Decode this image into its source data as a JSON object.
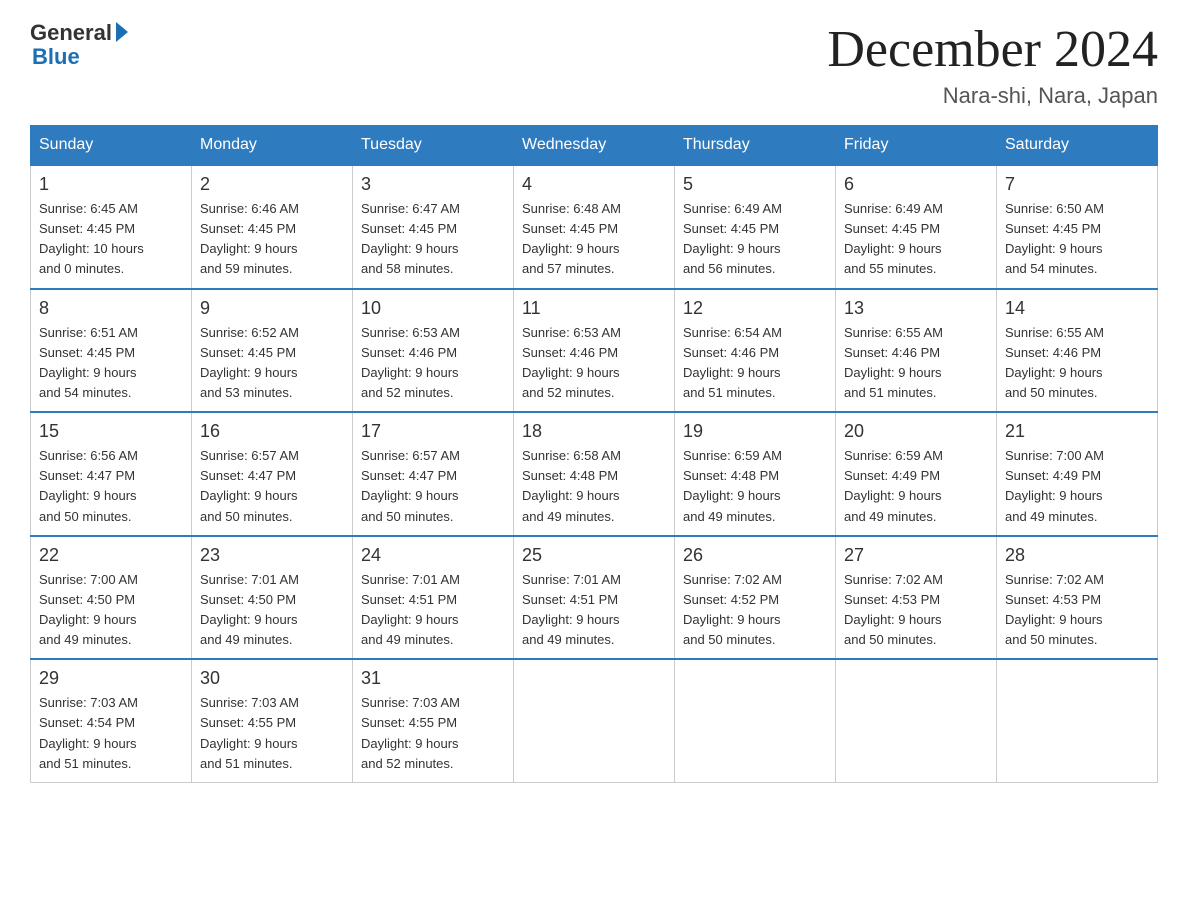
{
  "logo": {
    "general": "General",
    "blue": "Blue"
  },
  "title": "December 2024",
  "location": "Nara-shi, Nara, Japan",
  "weekdays": [
    "Sunday",
    "Monday",
    "Tuesday",
    "Wednesday",
    "Thursday",
    "Friday",
    "Saturday"
  ],
  "weeks": [
    [
      {
        "day": "1",
        "sunrise": "6:45 AM",
        "sunset": "4:45 PM",
        "daylight": "10 hours and 0 minutes."
      },
      {
        "day": "2",
        "sunrise": "6:46 AM",
        "sunset": "4:45 PM",
        "daylight": "9 hours and 59 minutes."
      },
      {
        "day": "3",
        "sunrise": "6:47 AM",
        "sunset": "4:45 PM",
        "daylight": "9 hours and 58 minutes."
      },
      {
        "day": "4",
        "sunrise": "6:48 AM",
        "sunset": "4:45 PM",
        "daylight": "9 hours and 57 minutes."
      },
      {
        "day": "5",
        "sunrise": "6:49 AM",
        "sunset": "4:45 PM",
        "daylight": "9 hours and 56 minutes."
      },
      {
        "day": "6",
        "sunrise": "6:49 AM",
        "sunset": "4:45 PM",
        "daylight": "9 hours and 55 minutes."
      },
      {
        "day": "7",
        "sunrise": "6:50 AM",
        "sunset": "4:45 PM",
        "daylight": "9 hours and 54 minutes."
      }
    ],
    [
      {
        "day": "8",
        "sunrise": "6:51 AM",
        "sunset": "4:45 PM",
        "daylight": "9 hours and 54 minutes."
      },
      {
        "day": "9",
        "sunrise": "6:52 AM",
        "sunset": "4:45 PM",
        "daylight": "9 hours and 53 minutes."
      },
      {
        "day": "10",
        "sunrise": "6:53 AM",
        "sunset": "4:46 PM",
        "daylight": "9 hours and 52 minutes."
      },
      {
        "day": "11",
        "sunrise": "6:53 AM",
        "sunset": "4:46 PM",
        "daylight": "9 hours and 52 minutes."
      },
      {
        "day": "12",
        "sunrise": "6:54 AM",
        "sunset": "4:46 PM",
        "daylight": "9 hours and 51 minutes."
      },
      {
        "day": "13",
        "sunrise": "6:55 AM",
        "sunset": "4:46 PM",
        "daylight": "9 hours and 51 minutes."
      },
      {
        "day": "14",
        "sunrise": "6:55 AM",
        "sunset": "4:46 PM",
        "daylight": "9 hours and 50 minutes."
      }
    ],
    [
      {
        "day": "15",
        "sunrise": "6:56 AM",
        "sunset": "4:47 PM",
        "daylight": "9 hours and 50 minutes."
      },
      {
        "day": "16",
        "sunrise": "6:57 AM",
        "sunset": "4:47 PM",
        "daylight": "9 hours and 50 minutes."
      },
      {
        "day": "17",
        "sunrise": "6:57 AM",
        "sunset": "4:47 PM",
        "daylight": "9 hours and 50 minutes."
      },
      {
        "day": "18",
        "sunrise": "6:58 AM",
        "sunset": "4:48 PM",
        "daylight": "9 hours and 49 minutes."
      },
      {
        "day": "19",
        "sunrise": "6:59 AM",
        "sunset": "4:48 PM",
        "daylight": "9 hours and 49 minutes."
      },
      {
        "day": "20",
        "sunrise": "6:59 AM",
        "sunset": "4:49 PM",
        "daylight": "9 hours and 49 minutes."
      },
      {
        "day": "21",
        "sunrise": "7:00 AM",
        "sunset": "4:49 PM",
        "daylight": "9 hours and 49 minutes."
      }
    ],
    [
      {
        "day": "22",
        "sunrise": "7:00 AM",
        "sunset": "4:50 PM",
        "daylight": "9 hours and 49 minutes."
      },
      {
        "day": "23",
        "sunrise": "7:01 AM",
        "sunset": "4:50 PM",
        "daylight": "9 hours and 49 minutes."
      },
      {
        "day": "24",
        "sunrise": "7:01 AM",
        "sunset": "4:51 PM",
        "daylight": "9 hours and 49 minutes."
      },
      {
        "day": "25",
        "sunrise": "7:01 AM",
        "sunset": "4:51 PM",
        "daylight": "9 hours and 49 minutes."
      },
      {
        "day": "26",
        "sunrise": "7:02 AM",
        "sunset": "4:52 PM",
        "daylight": "9 hours and 50 minutes."
      },
      {
        "day": "27",
        "sunrise": "7:02 AM",
        "sunset": "4:53 PM",
        "daylight": "9 hours and 50 minutes."
      },
      {
        "day": "28",
        "sunrise": "7:02 AM",
        "sunset": "4:53 PM",
        "daylight": "9 hours and 50 minutes."
      }
    ],
    [
      {
        "day": "29",
        "sunrise": "7:03 AM",
        "sunset": "4:54 PM",
        "daylight": "9 hours and 51 minutes."
      },
      {
        "day": "30",
        "sunrise": "7:03 AM",
        "sunset": "4:55 PM",
        "daylight": "9 hours and 51 minutes."
      },
      {
        "day": "31",
        "sunrise": "7:03 AM",
        "sunset": "4:55 PM",
        "daylight": "9 hours and 52 minutes."
      },
      null,
      null,
      null,
      null
    ]
  ],
  "labels": {
    "sunrise": "Sunrise:",
    "sunset": "Sunset:",
    "daylight": "Daylight:"
  }
}
